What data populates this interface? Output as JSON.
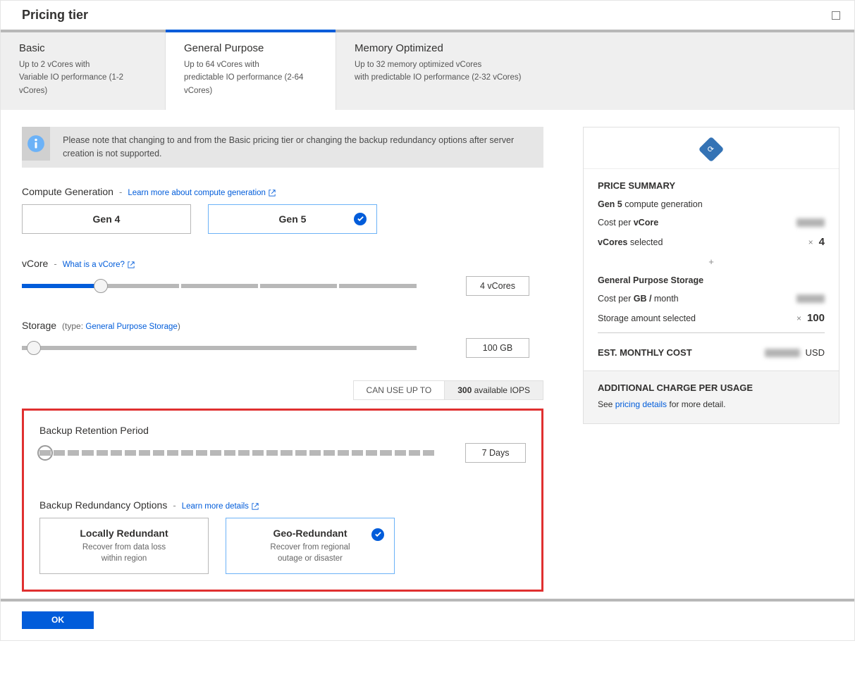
{
  "header": {
    "title": "Pricing tier"
  },
  "tabs": [
    {
      "title": "Basic",
      "sub": "Up to 2 vCores with\nVariable IO performance (1-2 vCores)"
    },
    {
      "title": "General Purpose",
      "sub": "Up to 64 vCores with\npredictable IO performance (2-64 vCores)"
    },
    {
      "title": "Memory Optimized",
      "sub": "Up to 32 memory optimized vCores\nwith predictable IO performance (2-32 vCores)"
    }
  ],
  "info": "Please note that changing to and from the Basic pricing tier or changing the backup redundancy options after server creation is not supported.",
  "compute": {
    "title": "Compute Generation",
    "link": "Learn more about compute generation",
    "gen4": "Gen 4",
    "gen5": "Gen 5"
  },
  "vcore": {
    "title": "vCore",
    "link": "What is a vCore?",
    "value": "4 vCores",
    "fillPercent": 20
  },
  "storage": {
    "title": "Storage",
    "typePrefix": "(type:",
    "typeLink": "General Purpose Storage",
    "typeSuffix": ")",
    "value": "100 GB",
    "iopsLabel": "CAN USE UP TO",
    "iopsBold": "300",
    "iopsRest": " available IOPS"
  },
  "backup": {
    "title": "Backup Retention Period",
    "value": "7 Days"
  },
  "redundancy": {
    "title": "Backup Redundancy Options",
    "link": "Learn more details",
    "options": [
      {
        "title": "Locally Redundant",
        "desc": "Recover from data loss\nwithin region"
      },
      {
        "title": "Geo-Redundant",
        "desc": "Recover from regional\noutage or disaster"
      }
    ]
  },
  "summary": {
    "heading": "PRICE SUMMARY",
    "gen_bold": "Gen 5",
    "gen_rest": " compute generation",
    "cost_vcore_prefix": "Cost per ",
    "cost_vcore_bold": "vCore",
    "vcores_bold": "vCores",
    "vcores_rest": " selected",
    "vcores_qty": "4",
    "storage_heading": "General Purpose Storage",
    "cost_gb_prefix": "Cost per ",
    "cost_gb_bold": "GB /",
    "cost_gb_rest": " month",
    "storage_amt_label": "Storage amount selected",
    "storage_qty": "100",
    "est_label": "EST. MONTHLY COST",
    "est_unit": "USD",
    "addl_heading": "ADDITIONAL CHARGE PER USAGE",
    "addl_prefix": "See ",
    "addl_link": "pricing details",
    "addl_suffix": " for more detail."
  },
  "footer": {
    "ok": "OK"
  }
}
